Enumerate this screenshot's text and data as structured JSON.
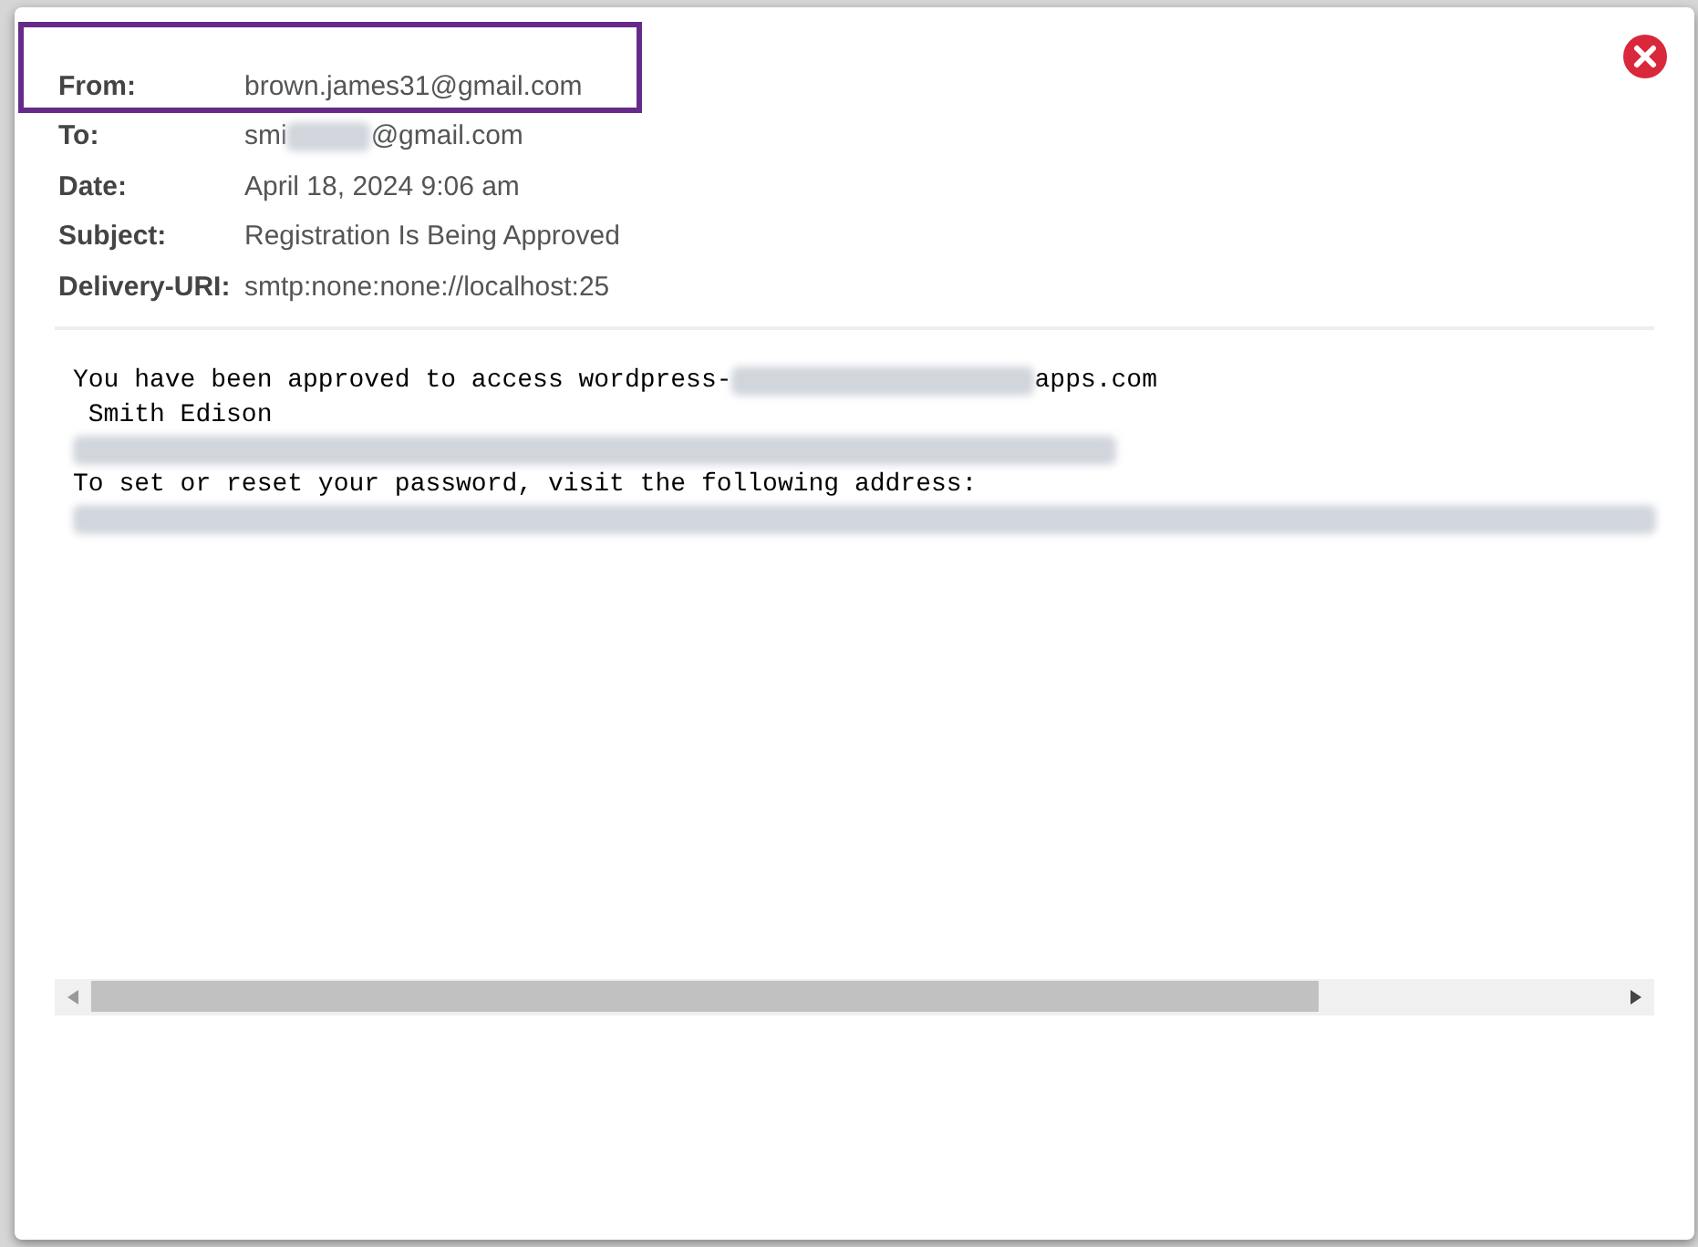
{
  "headers": [
    {
      "label": "From:",
      "parts": [
        "brown.james31@gmail.com"
      ],
      "highlighted": true
    },
    {
      "label": "To:",
      "parts": [
        "smi",
        "@gmail.com"
      ],
      "highlighted": false
    },
    {
      "label": "Date:",
      "parts": [
        "April 18, 2024 9:06 am"
      ],
      "highlighted": false
    },
    {
      "label": "Subject:",
      "parts": [
        "Registration Is Being Approved"
      ],
      "highlighted": false
    },
    {
      "label": "Delivery-URI:",
      "parts": [
        "smtp:none:none://localhost:25"
      ],
      "highlighted": false
    }
  ],
  "body": [
    {
      "kind": "text",
      "parts": [
        "You have been approved to access wordpress-",
        "apps.com"
      ]
    },
    {
      "kind": "text",
      "parts": [
        " Smith Edison"
      ]
    },
    {
      "kind": "redacted"
    },
    {
      "kind": "text",
      "parts": [
        "To set or reset your password, visit the following address:"
      ]
    },
    {
      "kind": "redacted"
    }
  ]
}
